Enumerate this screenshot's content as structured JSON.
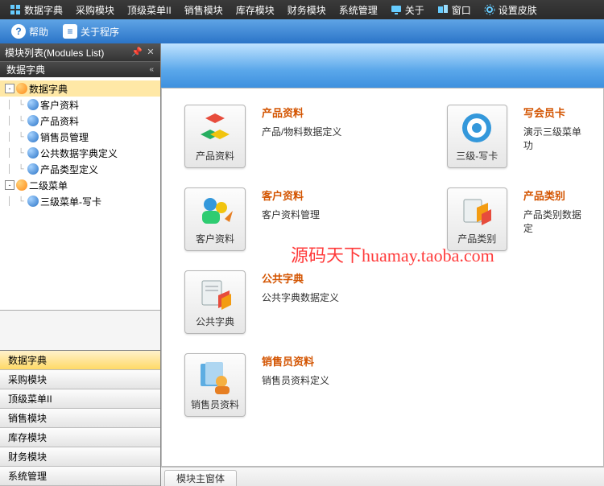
{
  "menubar": [
    {
      "label": "数据字典",
      "icon": "grid"
    },
    {
      "label": "采购模块",
      "icon": ""
    },
    {
      "label": "顶级菜单II",
      "icon": ""
    },
    {
      "label": "销售模块",
      "icon": ""
    },
    {
      "label": "库存模块",
      "icon": ""
    },
    {
      "label": "财务模块",
      "icon": ""
    },
    {
      "label": "系统管理",
      "icon": ""
    },
    {
      "label": "关于",
      "icon": "monitor"
    },
    {
      "label": "窗口",
      "icon": "windows"
    },
    {
      "label": "设置皮肤",
      "icon": "gear"
    }
  ],
  "toolbar": {
    "help_label": "帮助",
    "about_label": "关于程序"
  },
  "sidebar": {
    "panel_title": "模块列表(Modules List)",
    "section_title": "数据字典",
    "tree": [
      {
        "level": 0,
        "expand": "-",
        "icon": "orange",
        "label": "数据字典",
        "selected": true
      },
      {
        "level": 1,
        "expand": "",
        "icon": "blue",
        "label": "客户资料"
      },
      {
        "level": 1,
        "expand": "",
        "icon": "blue",
        "label": "产品资料"
      },
      {
        "level": 1,
        "expand": "",
        "icon": "blue",
        "label": "销售员管理"
      },
      {
        "level": 1,
        "expand": "",
        "icon": "blue",
        "label": "公共数据字典定义"
      },
      {
        "level": 1,
        "expand": "",
        "icon": "blue",
        "label": "产品类型定义"
      },
      {
        "level": 0,
        "expand": "-",
        "icon": "orange",
        "label": "二级菜单"
      },
      {
        "level": 1,
        "expand": "",
        "icon": "blue",
        "label": "三级菜单-写卡"
      }
    ],
    "modules": [
      {
        "label": "数据字典",
        "active": true
      },
      {
        "label": "采购模块"
      },
      {
        "label": "顶级菜单II"
      },
      {
        "label": "销售模块"
      },
      {
        "label": "库存模块"
      },
      {
        "label": "财务模块"
      },
      {
        "label": "系统管理"
      }
    ]
  },
  "content": {
    "watermark": "源码天下huamay.taoba.com",
    "cards": [
      [
        {
          "caption": "产品资料",
          "title": "产品资料",
          "desc": "产品/物料数据定义",
          "svg": "cubes"
        },
        {
          "caption": "三级-写卡",
          "title": "写会员卡",
          "desc": "演示三级菜单功",
          "svg": "target"
        }
      ],
      [
        {
          "caption": "客户资料",
          "title": "客户资料",
          "desc": "客户资料管理",
          "svg": "users"
        },
        {
          "caption": "产品类别",
          "title": "产品类别",
          "desc": "产品类别数据定",
          "svg": "boxdoc"
        }
      ],
      [
        {
          "caption": "公共字典",
          "title": "公共字典",
          "desc": "公共字典数据定义",
          "svg": "docbox"
        }
      ],
      [
        {
          "caption": "销售员资料",
          "title": "销售员资料",
          "desc": "销售员资料定义",
          "svg": "docuser"
        }
      ]
    ],
    "tab_label": "模块主窗体"
  }
}
